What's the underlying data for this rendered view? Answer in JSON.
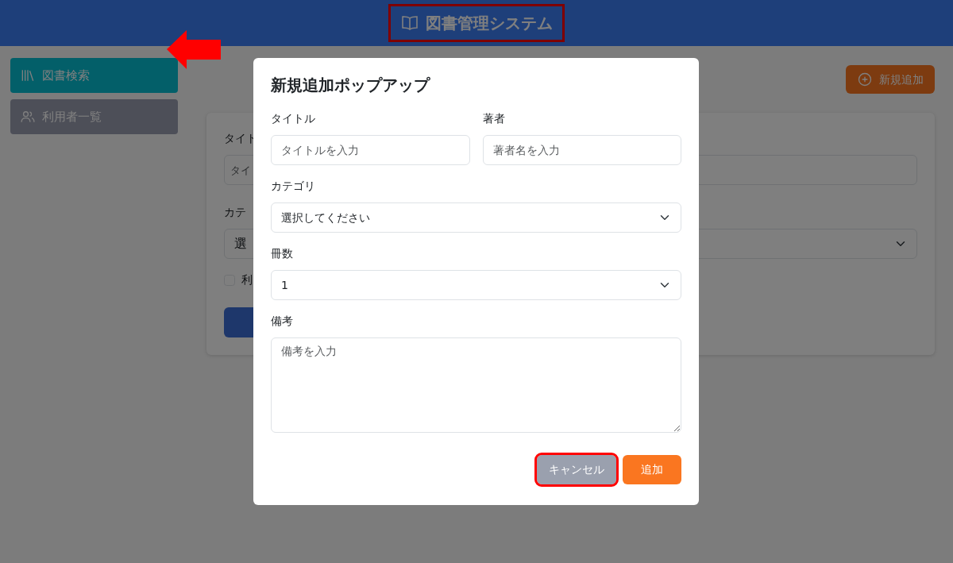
{
  "header": {
    "title": "図書管理システム",
    "highlighted": true
  },
  "sidebar": {
    "items": [
      {
        "label": "図書検索",
        "selected": true
      },
      {
        "label": "利用者一覧",
        "selected": false
      }
    ]
  },
  "add_button": {
    "label": "新規追加"
  },
  "search_form": {
    "title_label": "タイト",
    "title_placeholder": "タイ",
    "category_label": "カテ",
    "category_value": "選",
    "checkbox": {
      "label": "利",
      "checked": false
    }
  },
  "modal": {
    "title": "新規追加ポップアップ",
    "fields": [
      {
        "kind": "input",
        "label": "タイトル",
        "placeholder": "タイトルを入力"
      },
      {
        "kind": "input",
        "label": "著者",
        "placeholder": "著者名を入力"
      },
      {
        "kind": "select",
        "label": "カテゴリ",
        "value": "選択してください"
      },
      {
        "kind": "select",
        "label": "冊数",
        "value": "1"
      },
      {
        "kind": "textarea",
        "label": "備考",
        "placeholder": "備考を入力"
      }
    ],
    "buttons": [
      {
        "label": "キャンセル",
        "kind": "cancel",
        "highlighted": true
      },
      {
        "label": "追加",
        "kind": "primary",
        "highlighted": false
      }
    ]
  }
}
